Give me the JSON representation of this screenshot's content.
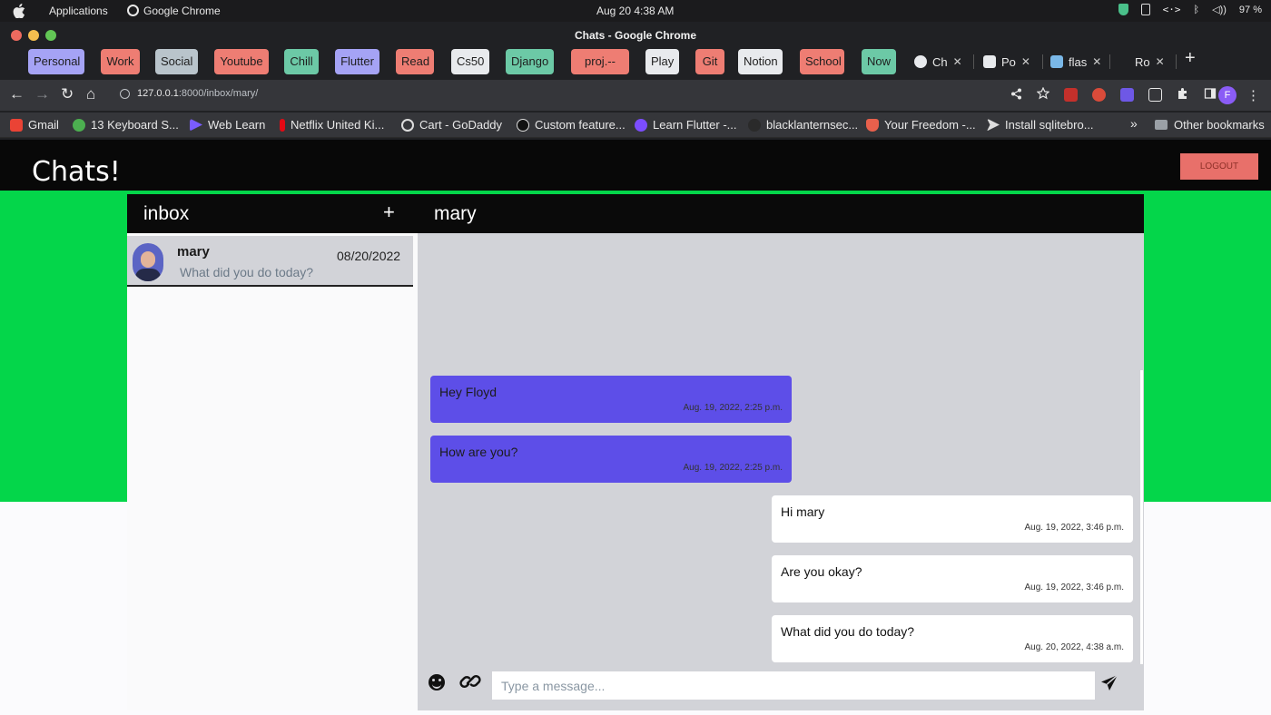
{
  "menubar": {
    "apps_label": "Applications",
    "chrome_label": "Google Chrome",
    "clock": "Aug 20   4:38 AM",
    "tray": {
      "code_label": "<·>",
      "bluetooth": "ᛒ",
      "volume": "◁))",
      "battery": "97 %"
    }
  },
  "window": {
    "title": "Chats - Google Chrome"
  },
  "tab_groups": [
    {
      "label": "Personal",
      "color": "#a5a3f5"
    },
    {
      "label": "Work",
      "color": "#ee7d73"
    },
    {
      "label": "Social",
      "color": "#b9c4cb"
    },
    {
      "label": "Youtube",
      "color": "#ee7d73"
    },
    {
      "label": "Chill",
      "color": "#6cc9a6"
    },
    {
      "label": "Flutter",
      "color": "#a5a3f5"
    },
    {
      "label": "Read",
      "color": "#ee7d73"
    },
    {
      "label": "Cs50",
      "color": "#e8eaed"
    },
    {
      "label": "Django",
      "color": "#6cc9a6"
    },
    {
      "label": "proj.--ref.",
      "color": "#ee7d73"
    },
    {
      "label": "Play",
      "color": "#e8eaed"
    },
    {
      "label": "Git",
      "color": "#ee7d73"
    },
    {
      "label": "Notion",
      "color": "#e8eaed"
    },
    {
      "label": "School",
      "color": "#ee7d73"
    },
    {
      "label": "Now",
      "color": "#6cc9a6"
    }
  ],
  "tabs": [
    {
      "label": "Ch",
      "close": "✕"
    },
    {
      "label": "Po",
      "close": "✕"
    },
    {
      "label": "flas",
      "close": "✕"
    },
    {
      "label": "Ro",
      "close": "✕"
    }
  ],
  "new_tab": "+",
  "toolbar": {
    "back": "←",
    "forward": "→",
    "reload": "↻",
    "home": "⌂",
    "url_host": "127.0.0.1",
    "url_path": ":8000/inbox/mary/",
    "profile": "F",
    "menu": "⋮"
  },
  "bookmarks": [
    {
      "label": "Gmail",
      "icon": "gmail-icon",
      "color": "#ea4335"
    },
    {
      "label": "13 Keyboard S...",
      "icon": "keyboard-icon",
      "color": "#4caf50"
    },
    {
      "label": "Web Learn",
      "icon": "play-icon",
      "color": "#7a5cff"
    },
    {
      "label": "Netflix United Ki...",
      "icon": "netflix-icon",
      "color": "#e50914"
    },
    {
      "label": "Cart - GoDaddy",
      "icon": "godaddy-icon",
      "color": "#dddddd"
    },
    {
      "label": "Custom feature...",
      "icon": "circle-icon",
      "color": "#111111"
    },
    {
      "label": "Learn Flutter -...",
      "icon": "flutter-icon",
      "color": "#7c4dff"
    },
    {
      "label": "blacklanternsec...",
      "icon": "lantern-icon",
      "color": "#2a2a2a"
    },
    {
      "label": "Your Freedom -...",
      "icon": "freedom-icon",
      "color": "#e8604c"
    },
    {
      "label": "Install sqlitebro...",
      "icon": "send-icon",
      "color": "#dddddd"
    }
  ],
  "bookmarks_more": "»",
  "bookmarks_other": "Other bookmarks",
  "app": {
    "brand": "Chats!",
    "logout": "LOGOUT",
    "inbox_title": "inbox",
    "new_chat": "+",
    "threads": [
      {
        "name": "mary",
        "date": "08/20/2022",
        "preview": "What did you do today?"
      }
    ],
    "conversation": {
      "name": "mary",
      "messages": [
        {
          "text": "Hey Floyd",
          "time": "Aug. 19, 2022, 2:25 p.m.",
          "direction": "in"
        },
        {
          "text": "How are you?",
          "time": "Aug. 19, 2022, 2:25 p.m.",
          "direction": "in"
        },
        {
          "text": "Hi mary",
          "time": "Aug. 19, 2022, 3:46 p.m.",
          "direction": "out"
        },
        {
          "text": "Are you okay?",
          "time": "Aug. 19, 2022, 3:46 p.m.",
          "direction": "out"
        },
        {
          "text": "What did you do today?",
          "time": "Aug. 20, 2022, 4:38 a.m.",
          "direction": "out"
        }
      ]
    },
    "composer_placeholder": "Type a message..."
  },
  "colors": {
    "header": "#080808",
    "accent_green": "#04d64a",
    "incoming_bubble": "#5d4ee8",
    "outgoing_bubble": "#ffffff",
    "logout": "#e8706a"
  }
}
